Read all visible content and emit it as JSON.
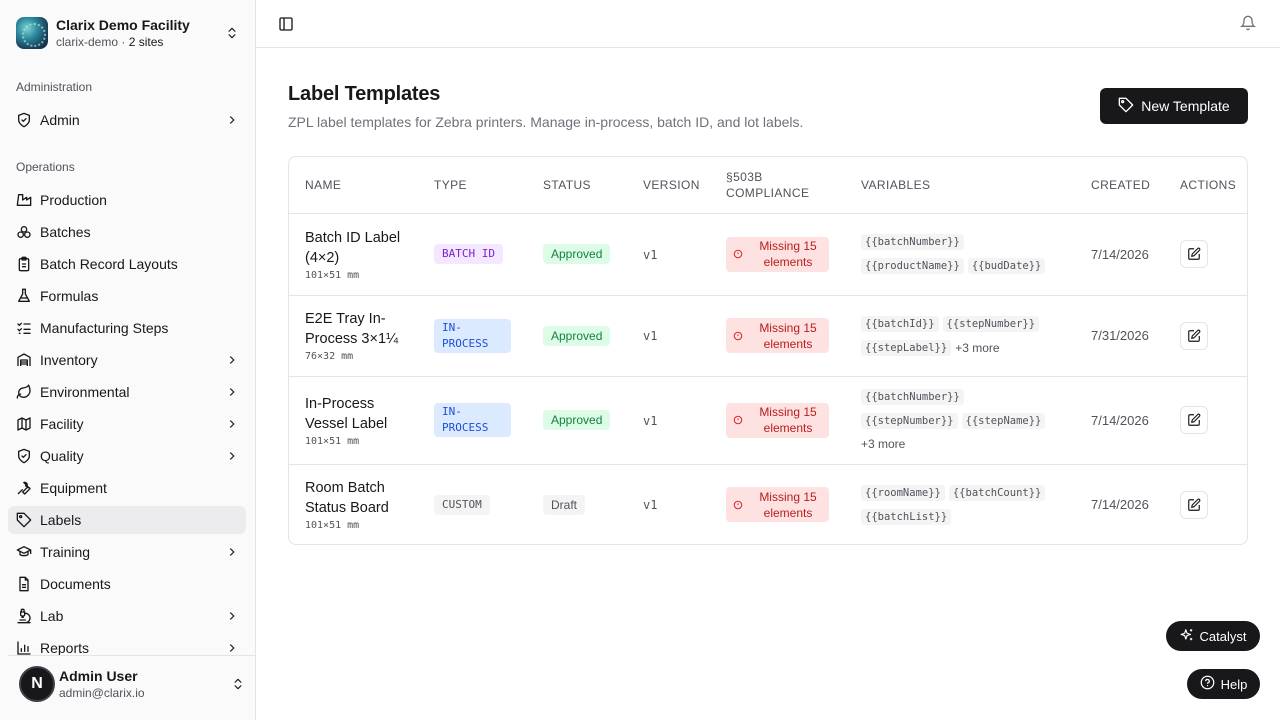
{
  "org": {
    "name": "Clarix Demo Facility",
    "slug": "clarix-demo",
    "separator": " · ",
    "sites": "2 sites"
  },
  "sidebar": {
    "admin_section": "Administration",
    "ops_section": "Operations",
    "items": [
      {
        "label": "Admin",
        "icon": "shield-check-icon",
        "chevron": true
      },
      {
        "label": "Production",
        "icon": "factory-icon",
        "chevron": false
      },
      {
        "label": "Batches",
        "icon": "boxes-icon",
        "chevron": false
      },
      {
        "label": "Batch Record Layouts",
        "icon": "clipboard-icon",
        "chevron": false
      },
      {
        "label": "Formulas",
        "icon": "flask-icon",
        "chevron": false
      },
      {
        "label": "Manufacturing Steps",
        "icon": "list-checks-icon",
        "chevron": false
      },
      {
        "label": "Inventory",
        "icon": "warehouse-icon",
        "chevron": true
      },
      {
        "label": "Environmental",
        "icon": "leaf-icon",
        "chevron": true
      },
      {
        "label": "Facility",
        "icon": "map-icon",
        "chevron": true
      },
      {
        "label": "Quality",
        "icon": "shield-check-icon",
        "chevron": true
      },
      {
        "label": "Equipment",
        "icon": "wrench-icon",
        "chevron": false
      },
      {
        "label": "Labels",
        "icon": "tag-icon",
        "chevron": false
      },
      {
        "label": "Training",
        "icon": "graduation-cap-icon",
        "chevron": true
      },
      {
        "label": "Documents",
        "icon": "file-text-icon",
        "chevron": false
      },
      {
        "label": "Lab",
        "icon": "microscope-icon",
        "chevron": true
      },
      {
        "label": "Reports",
        "icon": "bar-chart-icon",
        "chevron": true
      }
    ],
    "active": "Labels"
  },
  "user": {
    "initial": "N",
    "name": "Admin User",
    "email": "admin@clarix.io"
  },
  "page": {
    "title": "Label Templates",
    "subtitle": "ZPL label templates for Zebra printers. Manage in-process, batch ID, and lot labels.",
    "new_button": "New Template"
  },
  "table": {
    "columns": [
      "Name",
      "Type",
      "Status",
      "Version",
      "§503B Compliance",
      "Variables",
      "Created",
      "Actions"
    ],
    "rows": [
      {
        "name": "Batch ID Label (4×2)",
        "size": "101×51 mm",
        "type": "BATCH ID",
        "status": "Approved",
        "version": "v1",
        "compliance": "Missing 15 elements",
        "vars": [
          "{{batchNumber}}",
          "{{productName}}",
          "{{budDate}}"
        ],
        "more": "",
        "created": "7/14/2026"
      },
      {
        "name": "E2E Tray In-Process 3×1¼",
        "size": "76×32 mm",
        "type": "IN-PROCESS",
        "status": "Approved",
        "version": "v1",
        "compliance": "Missing 15 elements",
        "vars": [
          "{{batchId}}",
          "{{stepNumber}}",
          "{{stepLabel}}"
        ],
        "more": "+3 more",
        "created": "7/31/2026"
      },
      {
        "name": "In-Process Vessel Label",
        "size": "101×51 mm",
        "type": "IN-PROCESS",
        "status": "Approved",
        "version": "v1",
        "compliance": "Missing 15 elements",
        "vars": [
          "{{batchNumber}}",
          "{{stepNumber}}",
          "{{stepName}}"
        ],
        "more": "+3 more",
        "created": "7/14/2026"
      },
      {
        "name": "Room Batch Status Board",
        "size": "101×51 mm",
        "type": "CUSTOM",
        "status": "Draft",
        "version": "v1",
        "compliance": "Missing 15 elements",
        "vars": [
          "{{roomName}}",
          "{{batchCount}}",
          "{{batchList}}"
        ],
        "more": "",
        "created": "7/14/2026"
      }
    ]
  },
  "floating": {
    "catalyst": "Catalyst",
    "help": "Help"
  },
  "colors": {
    "primary": "#18181b",
    "approved_bg": "#dcfce7",
    "missing_bg": "#fee2e2",
    "batch_badge": "#f3e8ff",
    "inprocess_badge": "#dbeafe"
  }
}
